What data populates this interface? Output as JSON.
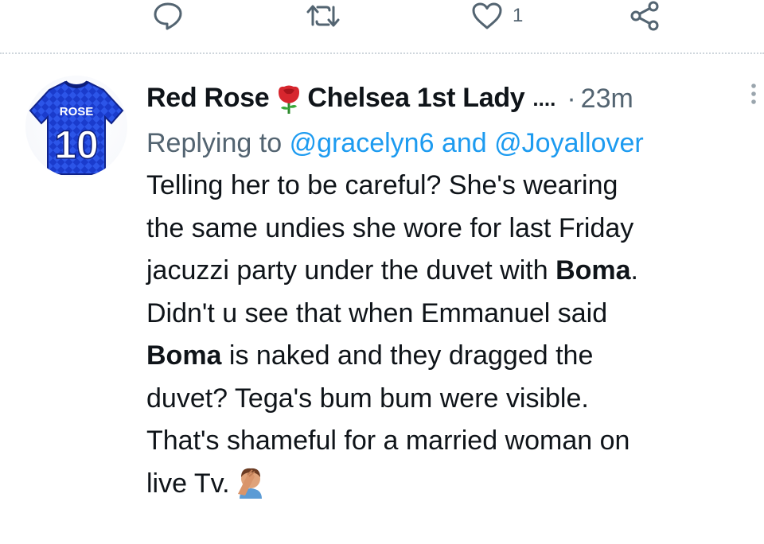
{
  "actions": {
    "reply_count": "",
    "retweet_count": "",
    "like_count": "1",
    "share_count": ""
  },
  "avatar": {
    "jersey_name": "ROSE",
    "jersey_number": "10",
    "jersey_color": "#1a3bcc"
  },
  "tweet": {
    "author_name_part1": "Red Rose",
    "author_name_part2": "Chelsea 1st Lady",
    "name_ellipsis": "....",
    "separator": "·",
    "timestamp": "23m",
    "replying_prefix": "Replying to",
    "mention_1": "@gracelyn6",
    "replying_and": "and",
    "mention_2": "@Joyallover",
    "lines": [
      "Telling her to be careful? She's wearing",
      "the same undies she wore for last Friday"
    ],
    "line3_pre": "jacuzzi party under the duvet with ",
    "line3_bold": "Boma",
    "line3_post": ".",
    "line4": "Didn't u see that when Emmanuel said",
    "line5_bold": "Boma",
    "line5_post": " is naked and they dragged the",
    "line6": "duvet? Tega's bum bum were visible.",
    "line7": "That's shameful for a married woman on",
    "line8": "live Tv.",
    "emoji_icon": "facepalm-emoji",
    "name_emoji_icon": "rose-emoji"
  },
  "colors": {
    "text": "#0f1419",
    "secondary": "#536471",
    "link": "#1d9bf0"
  }
}
